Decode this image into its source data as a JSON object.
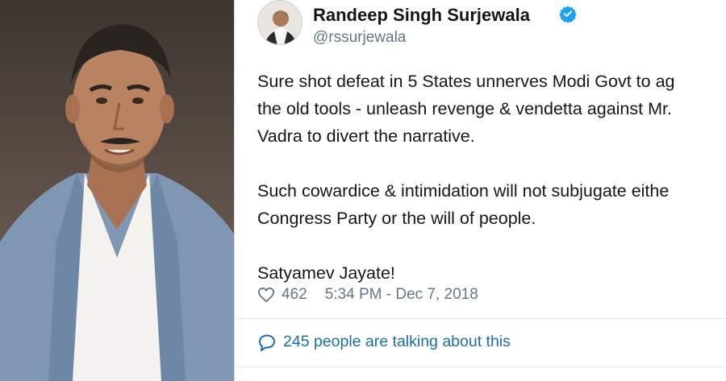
{
  "photo": {
    "alt_icon": "person-photo",
    "colors": {
      "jacket": "#7f97b3",
      "shirt": "#f4f2ef",
      "skin": "#b98361",
      "hair": "#2a2420"
    }
  },
  "tweet": {
    "author": {
      "display_name": "Randeep Singh Surjewala",
      "handle": "@rssurjewala",
      "verified": true
    },
    "text": "Sure shot defeat in 5 States unnerves Modi Govt to ag\nthe old tools - unleash revenge & vendetta against Mr.\nVadra to divert the narrative.\n\nSuch cowardice & intimidation will not subjugate eithe\nCongress Party or the will of people.\n\nSatyamev Jayate!",
    "likes": "462",
    "timestamp": "5:34 PM - Dec 7, 2018",
    "talking_text": "245 people are talking about this",
    "colors": {
      "text": "#14171a",
      "muted": "#657786",
      "link": "#1b6fa8",
      "verified": "#1da1f2"
    }
  }
}
